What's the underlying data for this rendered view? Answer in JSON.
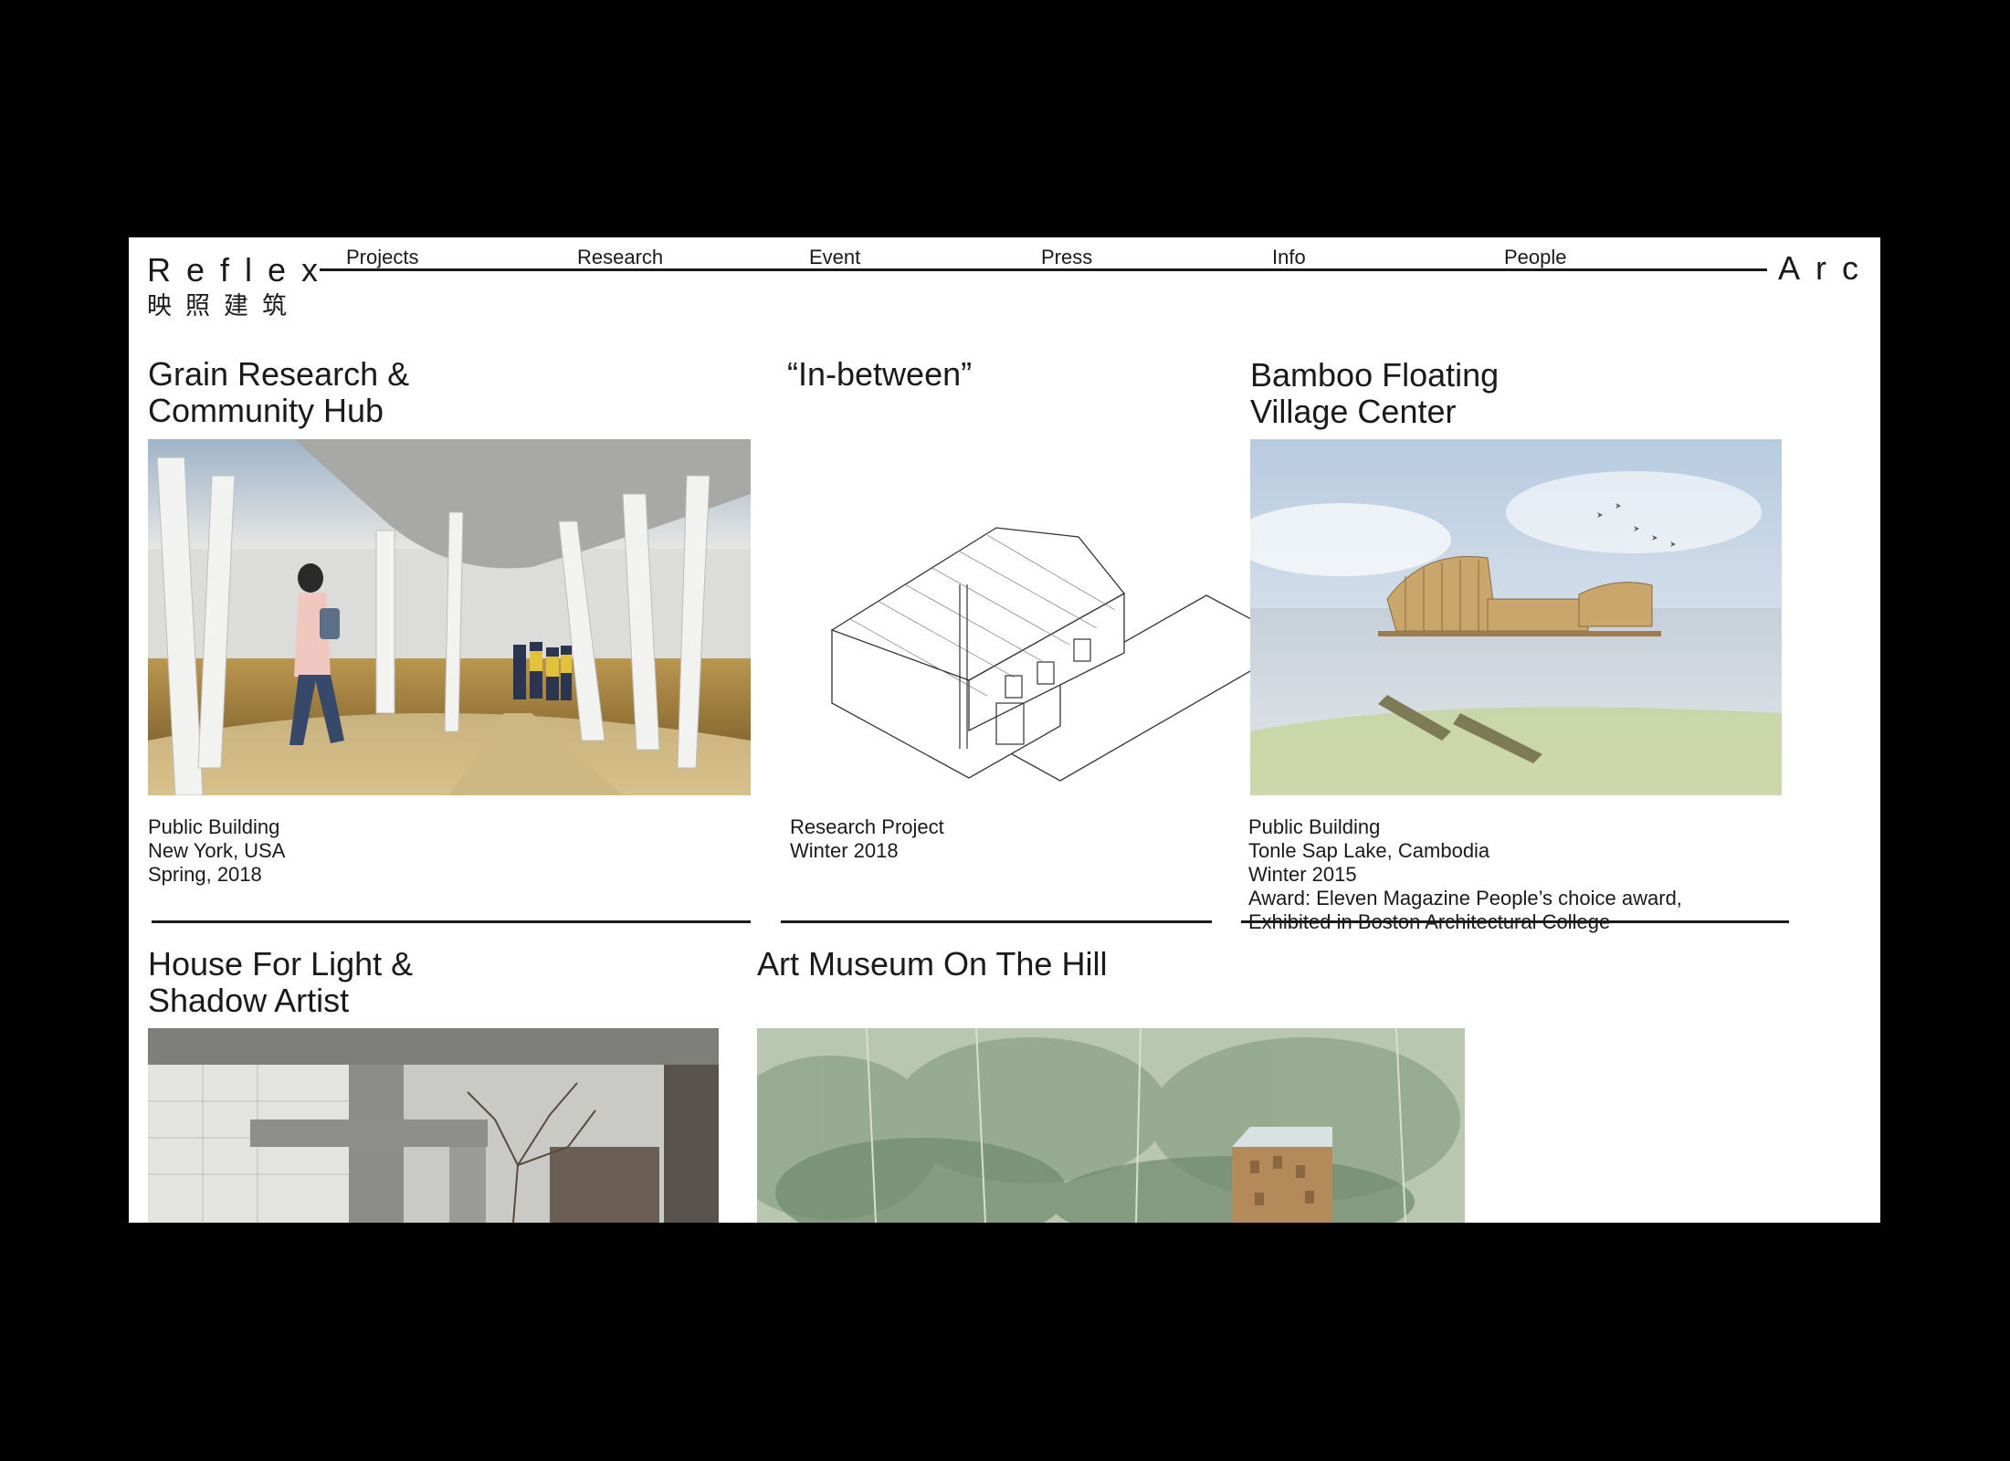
{
  "brand": {
    "name_en": "Reflex",
    "name_cn": "映照建筑",
    "suffix": "Arc"
  },
  "nav": [
    "Projects",
    "Research",
    "Event",
    "Press",
    "Info",
    "People"
  ],
  "projects": [
    {
      "title_1": "Grain Research &",
      "title_2": "Community Hub",
      "meta": [
        "Public Building",
        "New York, USA",
        "Spring, 2018"
      ]
    },
    {
      "title_1": "“In-between”",
      "title_2": "",
      "meta": [
        "Research Project",
        "Winter 2018"
      ]
    },
    {
      "title_1": "Bamboo Floating",
      "title_2": "Village Center",
      "meta": [
        "Public Building",
        "Tonle Sap Lake, Cambodia",
        "Winter 2015",
        "Award: Eleven Magazine People’s choice award,",
        "Exhibited in Boston Architectural College"
      ]
    },
    {
      "title_1": "House For Light &",
      "title_2": "Shadow Artist"
    },
    {
      "title_1": "Art Museum On The Hill"
    }
  ],
  "colors": {
    "background": "#000000",
    "page": "#ffffff",
    "text": "#1a1a1a"
  }
}
